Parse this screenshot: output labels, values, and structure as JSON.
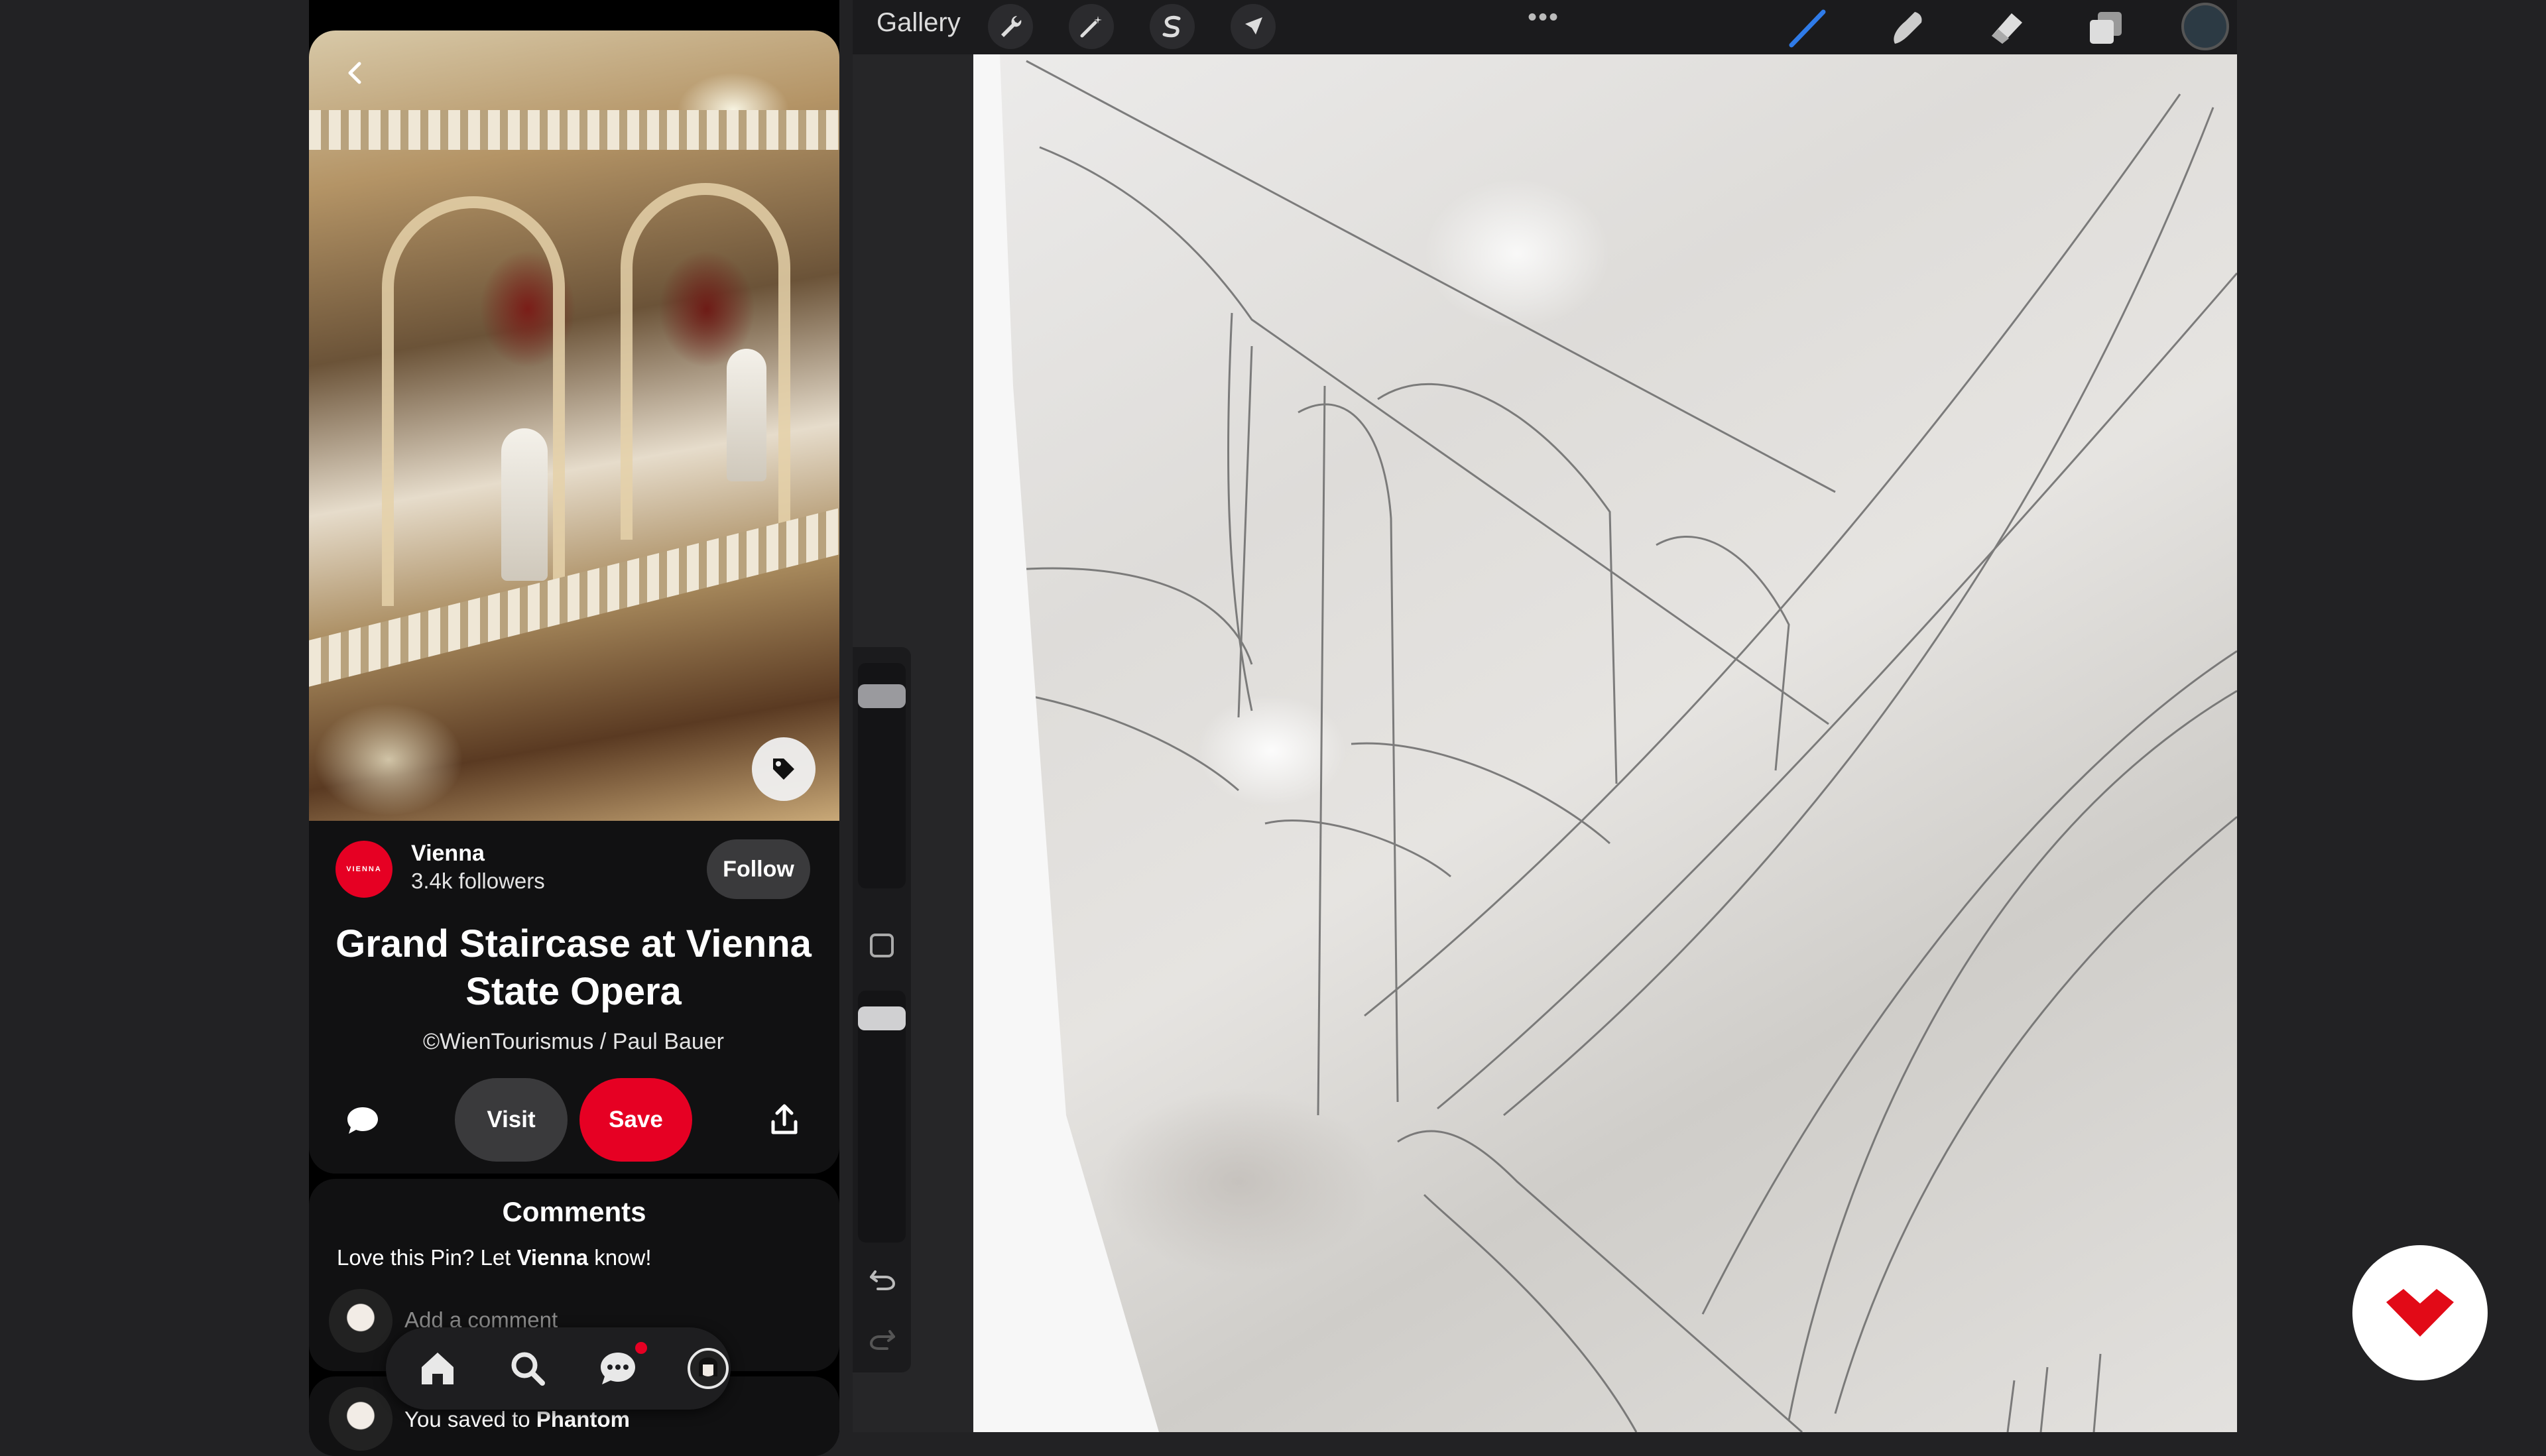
{
  "pinterest": {
    "author": {
      "avatar_text": "VIENNA",
      "name": "Vienna",
      "followers": "3.4k followers",
      "follow_label": "Follow"
    },
    "pin": {
      "title": "Grand Staircase at Vienna State Opera",
      "credit": "©WienTourismus / Paul Bauer"
    },
    "actions": {
      "visit_label": "Visit",
      "save_label": "Save"
    },
    "comments": {
      "heading": "Comments",
      "prompt_prefix": "Love this Pin? Let ",
      "prompt_name": "Vienna",
      "prompt_suffix": " know!",
      "placeholder": "Add a comment"
    },
    "activity": {
      "saved_prefix": "You saved to ",
      "saved_board": "Phantom"
    },
    "nav": [
      "home-icon",
      "search-icon",
      "messages-icon",
      "profile-icon"
    ],
    "colors": {
      "brand": "#e60023"
    }
  },
  "procreate": {
    "gallery_label": "Gallery",
    "left_tools": [
      "wrench-icon",
      "magic-wand-icon",
      "selection-icon",
      "transform-arrow-icon"
    ],
    "right_tools": [
      "brush-icon",
      "smudge-icon",
      "eraser-icon",
      "layers-icon"
    ],
    "colors": {
      "brush_active": "#2f7be8",
      "current_color": "#2c3a44"
    }
  },
  "overlay": {
    "logo": "domestika-logo-icon"
  }
}
